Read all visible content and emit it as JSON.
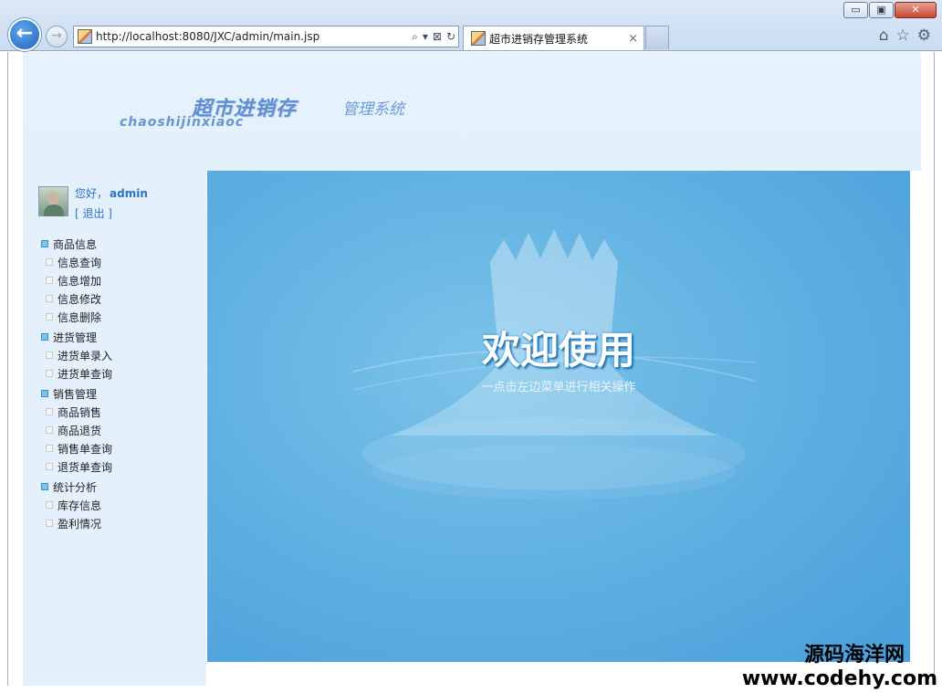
{
  "browser": {
    "url": "http://localhost:8080/JXC/admin/main.jsp",
    "tab_title": "超市进销存管理系统",
    "tab_close": "×",
    "back_glyph": "←",
    "forward_glyph": "→",
    "minimize": "▭",
    "restore": "▣",
    "close": "✕"
  },
  "header": {
    "logo_main": "超市进销存",
    "logo_sub": "管理系统",
    "logo_pinyin": "chaoshijinxiaoc"
  },
  "user": {
    "greeting": "您好，",
    "name": "admin",
    "logout": "[ 退出 ]"
  },
  "menu": {
    "groups": [
      {
        "title": "商品信息",
        "items": [
          "信息查询",
          "信息增加",
          "信息修改",
          "信息删除"
        ]
      },
      {
        "title": "进货管理",
        "items": [
          "进货单录入",
          "进货单查询"
        ]
      },
      {
        "title": "销售管理",
        "items": [
          "商品销售",
          "商品退货",
          "销售单查询",
          "退货单查询"
        ]
      },
      {
        "title": "统计分析",
        "items": [
          "库存信息",
          "盈利情况"
        ]
      }
    ]
  },
  "welcome": {
    "title": "欢迎使用",
    "subtitle": "一点击左边菜单进行相关操作"
  },
  "watermark": {
    "line1": "源码海洋网",
    "line2": "www.codehy.com"
  },
  "colors": {
    "accent": "#2a73c6",
    "sidebar_bg": "#e4f1fd",
    "welcome_bg": "#5aaee0"
  }
}
